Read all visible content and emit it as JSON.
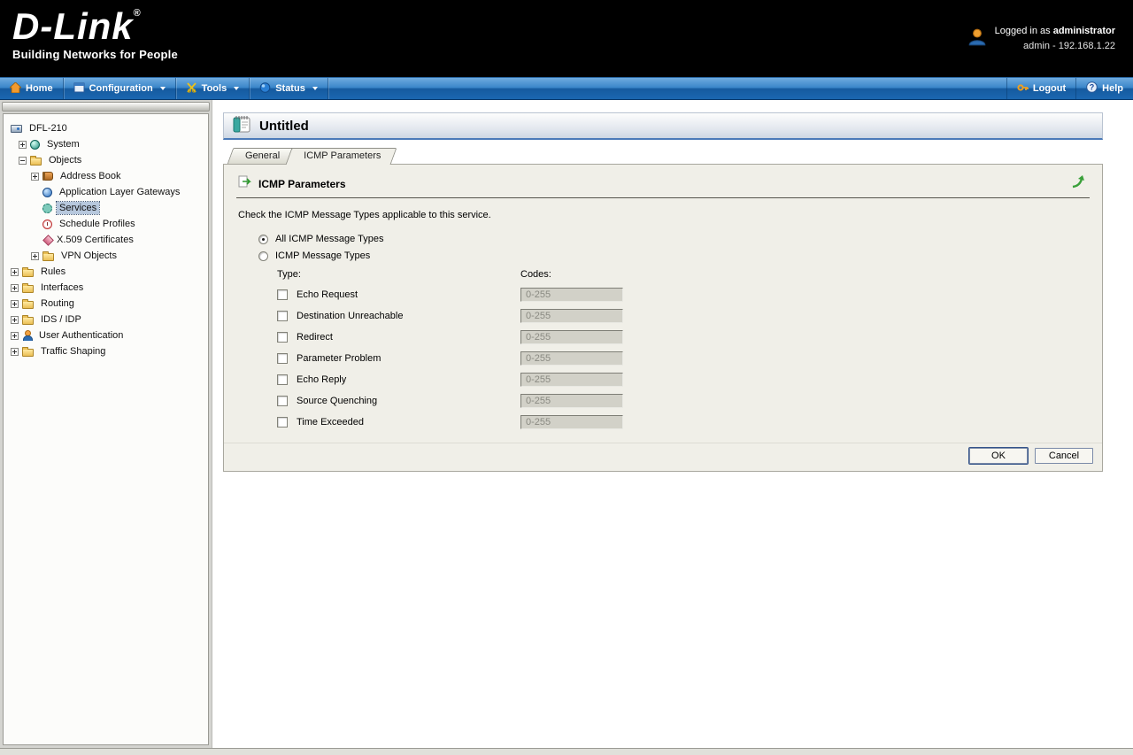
{
  "header": {
    "logo": "D-Link",
    "logo_reg": "®",
    "tagline": "Building Networks for People",
    "login_prefix": "Logged in as ",
    "login_user": "administrator",
    "login_detail": "admin - 192.168.1.22"
  },
  "navbar": {
    "home": "Home",
    "configuration": "Configuration",
    "tools": "Tools",
    "status": "Status",
    "logout": "Logout",
    "help": "Help"
  },
  "sidebar": {
    "items": [
      {
        "label": "DFL-210"
      },
      {
        "label": "System"
      },
      {
        "label": "Objects"
      },
      {
        "label": "Address Book"
      },
      {
        "label": "Application Layer Gateways"
      },
      {
        "label": "Services"
      },
      {
        "label": "Schedule Profiles"
      },
      {
        "label": "X.509 Certificates"
      },
      {
        "label": "VPN Objects"
      },
      {
        "label": "Rules"
      },
      {
        "label": "Interfaces"
      },
      {
        "label": "Routing"
      },
      {
        "label": "IDS / IDP"
      },
      {
        "label": "User Authentication"
      },
      {
        "label": "Traffic Shaping"
      }
    ],
    "selected": "Services"
  },
  "main": {
    "title": "Untitled",
    "tabs": {
      "general": "General",
      "icmp": "ICMP Parameters"
    },
    "section_title": "ICMP Parameters",
    "description": "Check the ICMP Message Types applicable to this service.",
    "radio_all": "All ICMP Message Types",
    "radio_types": "ICMP Message Types",
    "type_header": "Type:",
    "codes_header": "Codes:",
    "rows": [
      {
        "label": "Echo Request",
        "code": "0-255"
      },
      {
        "label": "Destination Unreachable",
        "code": "0-255"
      },
      {
        "label": "Redirect",
        "code": "0-255"
      },
      {
        "label": "Parameter Problem",
        "code": "0-255"
      },
      {
        "label": "Echo Reply",
        "code": "0-255"
      },
      {
        "label": "Source Quenching",
        "code": "0-255"
      },
      {
        "label": "Time Exceeded",
        "code": "0-255"
      }
    ],
    "ok": "OK",
    "cancel": "Cancel"
  },
  "colors": {
    "nav_blue": "#1b67b1",
    "panel_bg": "#f0efe8",
    "selected_item_bg": "#b7c8dd",
    "title_border_blue": "#4a7ab8",
    "header_bg": "#000000"
  }
}
